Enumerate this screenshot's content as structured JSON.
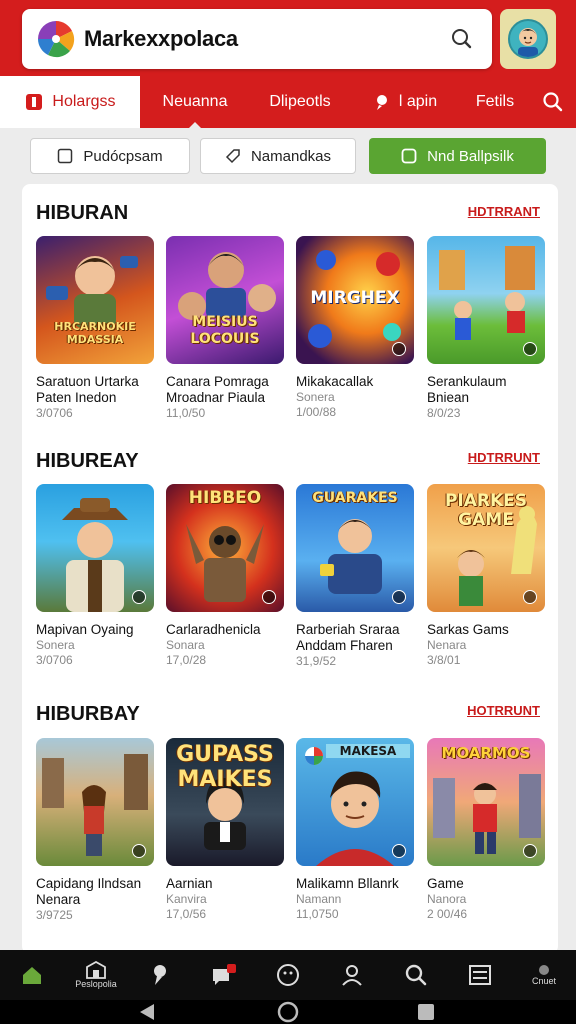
{
  "header": {
    "app_title": "Markexxpolaca"
  },
  "tabs": [
    {
      "label": "Holargss",
      "active": true
    },
    {
      "label": "Neuanna"
    },
    {
      "label": "Dlipeotls"
    },
    {
      "label": "l apin"
    },
    {
      "label": "Fetils"
    }
  ],
  "filters": [
    {
      "label": "Pudócpsam"
    },
    {
      "label": "Namandkas"
    },
    {
      "label": "Nnd Ballpsilk"
    }
  ],
  "sections": [
    {
      "title": "HIBURAN",
      "link": "HDTRRANT",
      "games": [
        {
          "thumb_text": "HRCARNOKIE MDASSIA",
          "name": "Saratuon Urtarka Paten Inedon",
          "sub": "",
          "num": "3/0706"
        },
        {
          "thumb_text": "MEISIUS LOCOUIS",
          "name": "Canara Pomraga Mroadnar Piaula",
          "sub": "",
          "num": "11,0/50"
        },
        {
          "thumb_text": "MIRGHEX",
          "name": "Mikakacallak",
          "sub": "Sonera",
          "num": "1/00/88"
        },
        {
          "thumb_text": "",
          "name": "Serankulaum Bniean",
          "sub": "",
          "num": "8/0/23"
        }
      ]
    },
    {
      "title": "HIBUREAY",
      "link": "HDTRRUNT",
      "games": [
        {
          "thumb_text": "",
          "name": "Mapivan Oyaing",
          "sub": "Sonera",
          "num": "3/0706"
        },
        {
          "thumb_text": "HIBBEO",
          "name": "Carlaradhenicla",
          "sub": "Sonara",
          "num": "17,0/28"
        },
        {
          "thumb_text": "GUARAKES",
          "name": "Rarberiah Sraraa Anddam Fharen",
          "sub": "",
          "num": "31,9/52"
        },
        {
          "thumb_text": "PIARKES GAME",
          "name": "Sarkas Gams",
          "sub": "Nenara",
          "num": "3/8/01"
        }
      ]
    },
    {
      "title": "HIBURBAY",
      "link": "HOTRRUNT",
      "games": [
        {
          "thumb_text": "",
          "name": "Capidang Ilndsan Nenara",
          "sub": "",
          "num": "3/9725"
        },
        {
          "thumb_text": "GUPASS MAIKES",
          "name": "Aarnian",
          "sub": "Kanvira",
          "num": "17,0/56"
        },
        {
          "thumb_text": "MAKESA",
          "name": "Malikamn Bllanrk",
          "sub": "Namann",
          "num": "11,0750"
        },
        {
          "thumb_text": "MOARMOS",
          "name": "Game",
          "sub": "Nanora",
          "num": "2 00/46"
        }
      ]
    }
  ],
  "bottom_nav": [
    {
      "icon": "home-icon",
      "label": ""
    },
    {
      "icon": "store-icon",
      "label": "Peslopolia"
    },
    {
      "icon": "pin-icon",
      "label": ""
    },
    {
      "icon": "notifications-icon",
      "label": ""
    },
    {
      "icon": "smiley-icon",
      "label": ""
    },
    {
      "icon": "person-icon",
      "label": ""
    },
    {
      "icon": "search-icon",
      "label": ""
    },
    {
      "icon": "list-icon",
      "label": ""
    },
    {
      "icon": "more-icon",
      "label": "Cnuet"
    }
  ],
  "colors": {
    "brand_red": "#d41d1d",
    "accent_green": "#5aa532"
  }
}
